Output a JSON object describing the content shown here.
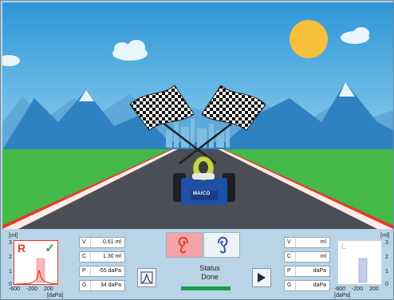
{
  "colors": {
    "sky": "#3aa0dc",
    "grass": "#45b84a",
    "road": "#4b4f55",
    "kerb_red": "#e53a2a",
    "kerb_white": "#ffffff",
    "right_ear": "#e53a2a",
    "left_ear": "#3a4fa8",
    "status_ok": "#1c9b4a"
  },
  "kart": {
    "brand": "MAICO"
  },
  "right_tymp": {
    "y_unit": "[ml]",
    "x_unit": "[daPa]",
    "side_letter": "R",
    "check_icon": "check-icon",
    "y_ticks": [
      "3",
      "2",
      "1",
      "0"
    ],
    "x_ticks": [
      "-600",
      "-200",
      "200"
    ],
    "peak_pressure_dapa": -55,
    "peak_compliance_ml": 0.61
  },
  "right_values": [
    {
      "key": "V",
      "value": "0.61 ml"
    },
    {
      "key": "C",
      "value": "1.30 ml"
    },
    {
      "key": "P",
      "value": "-55 daPa"
    },
    {
      "key": "G",
      "value": "34 daPa"
    }
  ],
  "ear_selector": {
    "right_icon": "right-ear-icon",
    "left_icon": "left-ear-icon"
  },
  "status": {
    "label": "Status",
    "value": "Done",
    "progress": 1.0
  },
  "tools": {
    "tymp_icon": "tympanogram-icon",
    "play_icon": "play-icon"
  },
  "left_values": [
    {
      "key": "V",
      "value": "ml"
    },
    {
      "key": "C",
      "value": "ml"
    },
    {
      "key": "P",
      "value": "daPa"
    },
    {
      "key": "G",
      "value": "daPa"
    }
  ],
  "left_tymp": {
    "y_unit": "[ml]",
    "x_unit": "[daPa]",
    "side_letter": "L",
    "y_ticks": [
      "3",
      "2",
      "1",
      "0"
    ],
    "x_ticks": [
      "-600",
      "-200",
      "200"
    ]
  }
}
